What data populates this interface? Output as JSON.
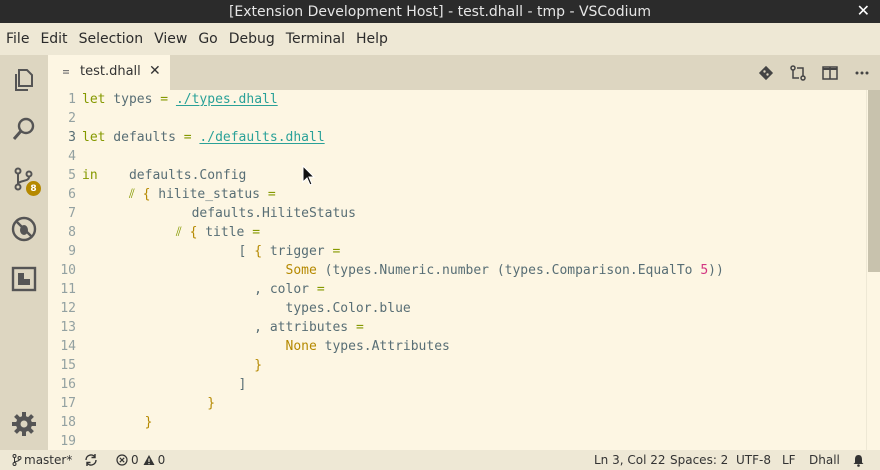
{
  "window": {
    "title": "[Extension Development Host] - test.dhall - tmp - VSCodium",
    "close_glyph": "✕"
  },
  "menu": [
    "File",
    "Edit",
    "Selection",
    "View",
    "Go",
    "Debug",
    "Terminal",
    "Help"
  ],
  "activity": {
    "scm_badge": "8"
  },
  "tab": {
    "label": "test.dhall",
    "close_glyph": "✕"
  },
  "editor": {
    "active_line": 3,
    "line_numbers": [
      "1",
      "2",
      "3",
      "4",
      "5",
      "6",
      "7",
      "8",
      "9",
      "10",
      "11",
      "12",
      "13",
      "14",
      "15",
      "16",
      "17",
      "18",
      "19"
    ]
  },
  "statusbar": {
    "branch": "master*",
    "errors": "0",
    "warnings": "0",
    "position": "Ln 3, Col 22",
    "spaces": "Spaces: 2",
    "encoding": "UTF-8",
    "eol": "LF",
    "language": "Dhall"
  },
  "colors": {
    "background": "#fdf6e3",
    "keyword": "#859900",
    "path": "#2aa198",
    "constructor": "#b58900",
    "number": "#d33682",
    "badge": "#b58900"
  }
}
